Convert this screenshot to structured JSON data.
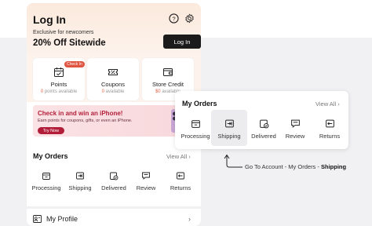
{
  "header": {
    "title": "Log In",
    "promo_subtitle": "Exclusive for newcomers",
    "promo_title": "20% Off Sitewide",
    "login_button": "Log In"
  },
  "cards": [
    {
      "label": "Points",
      "badge": "Check In",
      "value": "0",
      "value_suffix": " points available",
      "icon": "calendar-check-icon"
    },
    {
      "label": "Coupons",
      "value": "0",
      "value_suffix": " available",
      "icon": "coupon-icon"
    },
    {
      "label": "Store Credit",
      "value": "$0",
      "value_suffix": " available",
      "icon": "wallet-icon"
    }
  ],
  "banner": {
    "title": "Check in and win an iPhone!",
    "subtitle": "Earn points for coupons, gifts, or even an iPhone.",
    "button": "Try Now"
  },
  "orders": {
    "title": "My Orders",
    "view_all": "View All",
    "items": [
      {
        "label": "Processing",
        "icon": "processing-box-icon"
      },
      {
        "label": "Shipping",
        "icon": "shipping-icon"
      },
      {
        "label": "Delivered",
        "icon": "delivered-icon"
      },
      {
        "label": "Review",
        "icon": "review-icon"
      },
      {
        "label": "Returns",
        "icon": "returns-icon"
      }
    ]
  },
  "profile": {
    "label": "My Profile"
  },
  "annotation": {
    "prefix": "Go To Account - My Orders - ",
    "highlight": "Shipping"
  },
  "colors": {
    "accent_red": "#b21e3a",
    "badge_red": "#e05542",
    "header_peach": "#fbe9dc",
    "button_dark": "#1b1b1b"
  }
}
